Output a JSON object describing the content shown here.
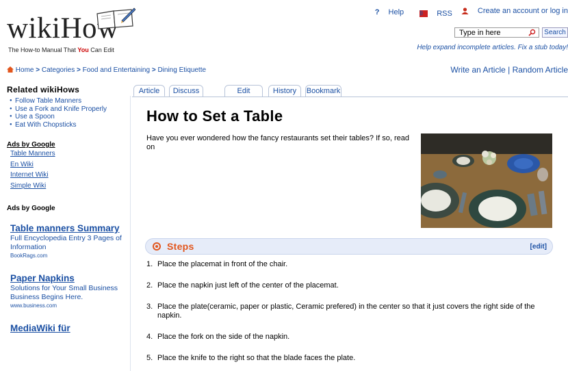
{
  "logo": {
    "word": "wikiHow",
    "tagline_pre": "The How-to Manual That ",
    "tagline_you": "You",
    "tagline_post": " Can Edit"
  },
  "toplinks": {
    "help": "Help",
    "rss": "RSS",
    "account": "Create an account or log in"
  },
  "search": {
    "placeholder": "Type in here",
    "button": "Search"
  },
  "stub_text": "Help expand incomplete articles. Fix a stub today!",
  "breadcrumb": [
    "Home",
    "Categories",
    "Food and Entertaining",
    "Dining Etiquette"
  ],
  "actions": {
    "write": "Write an Article",
    "sep": "|",
    "random": "Random Article"
  },
  "sidebar": {
    "related_title": "Related wikiHows",
    "related": [
      "Follow Table Manners",
      "Use a Fork and Knife Properly",
      "Use a Spoon",
      "Eat With Chopsticks"
    ],
    "ads_title_1": "Ads by Google",
    "ad_links": [
      "Table Manners",
      "En Wiki",
      "Internet Wiki",
      "Simple Wiki"
    ],
    "ads_title_2": "Ads by Google",
    "ads": [
      {
        "title": "Table manners Summary",
        "desc": "Full Encyclopedia Entry 3 Pages of Information",
        "url": "BookRags.com"
      },
      {
        "title": "Paper Napkins",
        "desc": "Solutions for Your Small Business Business Begins Here.",
        "url": "www.business.com"
      },
      {
        "title": "MediaWiki für",
        "desc": "",
        "url": ""
      }
    ]
  },
  "tabs": [
    "Article",
    "Discuss",
    "Edit",
    "History",
    "Bookmark"
  ],
  "article": {
    "title": "How to Set a Table",
    "intro": "Have you ever wondered how the fancy restaurants set their tables? If so, read on",
    "steps_label": "Steps",
    "edit_label": "[edit]",
    "steps": [
      "Place the placemat in front of the chair.",
      "Place the napkin just left of the center of the placemat.",
      "Place the plate(ceramic, paper or plastic, Ceramic prefered) in the center so that it just covers the right side of the napkin.",
      "Place the fork on the side of the napkin.",
      "Place the knife to the right so that the blade faces the plate."
    ]
  },
  "colors": {
    "link": "#1a4fa3",
    "accent": "#e2561d",
    "steps_bar": "#e6ecf9"
  }
}
